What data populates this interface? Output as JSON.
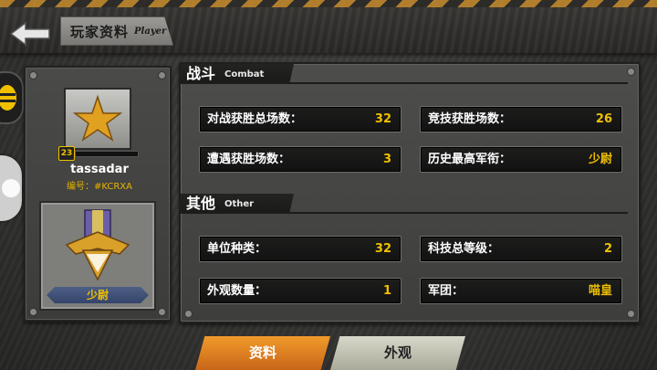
{
  "header": {
    "title_cn": "玩家资料",
    "title_en": "Player"
  },
  "player": {
    "level": "23",
    "name": "tassadar",
    "id_text": "编号：#KCRXA",
    "rank": "少尉"
  },
  "sections": {
    "combat": {
      "title_cn": "战斗",
      "title_en": "Combat",
      "stats": [
        {
          "label": "对战获胜总场数：",
          "value": "32"
        },
        {
          "label": "竞技获胜场数：",
          "value": "26"
        },
        {
          "label": "遭遇获胜场数：",
          "value": "3"
        },
        {
          "label": "历史最高军衔：",
          "value": "少尉"
        }
      ]
    },
    "other": {
      "title_cn": "其他",
      "title_en": "Other",
      "stats": [
        {
          "label": "单位种类：",
          "value": "32"
        },
        {
          "label": "科技总等级：",
          "value": "2"
        },
        {
          "label": "外观数量：",
          "value": "1"
        },
        {
          "label": "军团：",
          "value": "喵皇"
        }
      ]
    }
  },
  "tabs": [
    {
      "label": "资料",
      "active": true
    },
    {
      "label": "外观",
      "active": false
    }
  ],
  "colors": {
    "accent_yellow": "#f0c000",
    "tab_active": "#e88a28",
    "tab_inactive": "#c8c9b9"
  }
}
